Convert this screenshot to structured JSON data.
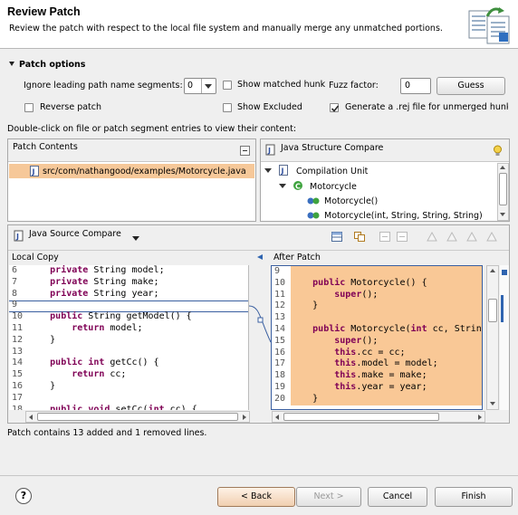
{
  "header": {
    "title": "Review Patch",
    "subtitle": "Review the patch with respect to the local file system and manually merge any unmatched portions."
  },
  "options": {
    "section_label": "Patch options",
    "ignore_label": "Ignore leading path name segments:",
    "ignore_value": "0",
    "show_matched_label": "Show matched hunk",
    "fuzz_label": "Fuzz factor:",
    "fuzz_value": "0",
    "guess_label": "Guess",
    "reverse_label": "Reverse patch",
    "show_excluded_label": "Show Excluded",
    "generate_rej_label": "Generate a .rej file for unmerged hunk"
  },
  "instructions": "Double-click on file or patch segment entries to view their content:",
  "patch_contents": {
    "title": "Patch Contents",
    "file": "src/com/nathangood/examples/Motorcycle.java"
  },
  "structure": {
    "title": "Java Structure Compare",
    "items": [
      "Compilation Unit",
      "Motorcycle",
      "Motorcycle()",
      "Motorcycle(int, String, String, String)"
    ]
  },
  "source_compare": {
    "title": "Java Source Compare",
    "local_label": "Local Copy",
    "after_label": "After Patch",
    "local_lines": [
      {
        "n": "6",
        "t": "    private String model;"
      },
      {
        "n": "7",
        "t": "    private String make;"
      },
      {
        "n": "8",
        "t": "    private String year;"
      },
      {
        "n": "9",
        "t": ""
      },
      {
        "n": "10",
        "t": "    public String getModel() {"
      },
      {
        "n": "11",
        "t": "        return model;"
      },
      {
        "n": "12",
        "t": "    }"
      },
      {
        "n": "13",
        "t": ""
      },
      {
        "n": "14",
        "t": "    public int getCc() {"
      },
      {
        "n": "15",
        "t": "        return cc;"
      },
      {
        "n": "16",
        "t": "    }"
      },
      {
        "n": "17",
        "t": ""
      },
      {
        "n": "18",
        "t": "    public void setCc(int cc) {"
      }
    ],
    "after_lines": [
      {
        "n": "9",
        "t": ""
      },
      {
        "n": "10",
        "t": "    public Motorcycle() {"
      },
      {
        "n": "11",
        "t": "        super();"
      },
      {
        "n": "12",
        "t": "    }"
      },
      {
        "n": "13",
        "t": ""
      },
      {
        "n": "14",
        "t": "    public Motorcycle(int cc, String"
      },
      {
        "n": "15",
        "t": "        super();"
      },
      {
        "n": "16",
        "t": "        this.cc = cc;"
      },
      {
        "n": "17",
        "t": "        this.model = model;"
      },
      {
        "n": "18",
        "t": "        this.make = make;"
      },
      {
        "n": "19",
        "t": "        this.year = year;"
      },
      {
        "n": "20",
        "t": "    }"
      }
    ]
  },
  "status": "Patch contains 13 added and 1 removed lines.",
  "buttons": {
    "back": "< Back",
    "next": "Next >",
    "cancel": "Cancel",
    "finish": "Finish"
  },
  "colors": {
    "added_highlight": "#f9c896",
    "selection": "#f6c899",
    "keyword": "#7f0055"
  }
}
